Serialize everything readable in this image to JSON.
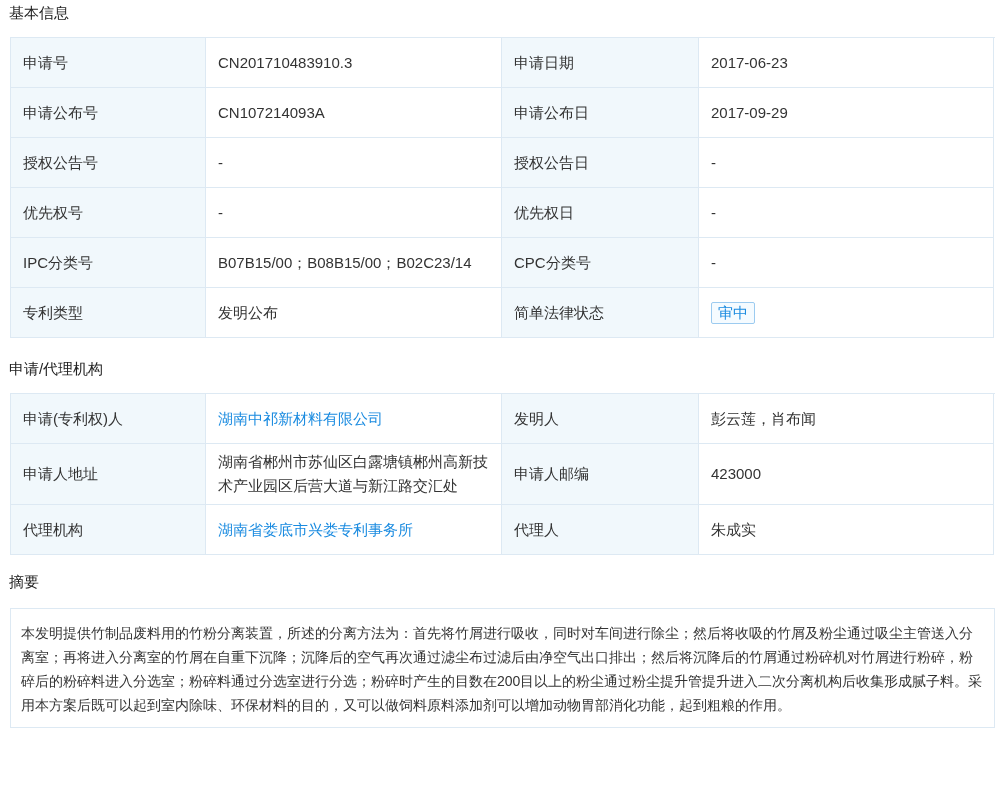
{
  "sections": [
    {
      "title": "基本信息",
      "rows": [
        {
          "cells": [
            {
              "kind": "label",
              "text": "申请号"
            },
            {
              "kind": "text",
              "text": "CN201710483910.3"
            },
            {
              "kind": "label",
              "text": "申请日期"
            },
            {
              "kind": "text",
              "text": "2017-06-23"
            }
          ]
        },
        {
          "cells": [
            {
              "kind": "label",
              "text": "申请公布号"
            },
            {
              "kind": "text",
              "text": "CN107214093A"
            },
            {
              "kind": "label",
              "text": "申请公布日"
            },
            {
              "kind": "text",
              "text": "2017-09-29"
            }
          ]
        },
        {
          "cells": [
            {
              "kind": "label",
              "text": "授权公告号"
            },
            {
              "kind": "text",
              "text": "-"
            },
            {
              "kind": "label",
              "text": "授权公告日"
            },
            {
              "kind": "text",
              "text": "-"
            }
          ]
        },
        {
          "cells": [
            {
              "kind": "label",
              "text": "优先权号"
            },
            {
              "kind": "text",
              "text": "-"
            },
            {
              "kind": "label",
              "text": "优先权日"
            },
            {
              "kind": "text",
              "text": "-"
            }
          ]
        },
        {
          "cells": [
            {
              "kind": "label",
              "text": "IPC分类号"
            },
            {
              "kind": "text",
              "text": "B07B15/00；B08B15/00；B02C23/14"
            },
            {
              "kind": "label",
              "text": "CPC分类号"
            },
            {
              "kind": "text",
              "text": "-"
            }
          ]
        },
        {
          "cells": [
            {
              "kind": "label",
              "text": "专利类型"
            },
            {
              "kind": "text",
              "text": "发明公布"
            },
            {
              "kind": "label",
              "text": "简单法律状态"
            },
            {
              "kind": "tag",
              "text": "审中"
            }
          ]
        }
      ]
    },
    {
      "title": "申请/代理机构",
      "rows": [
        {
          "cells": [
            {
              "kind": "label",
              "text": "申请(专利权)人"
            },
            {
              "kind": "link",
              "text": "湖南中祁新材料有限公司"
            },
            {
              "kind": "label",
              "text": "发明人"
            },
            {
              "kind": "text",
              "text": "彭云莲，肖布闻"
            }
          ]
        },
        {
          "cells": [
            {
              "kind": "label",
              "text": "申请人地址"
            },
            {
              "kind": "text",
              "text": "湖南省郴州市苏仙区白露塘镇郴州高新技术产业园区后营大道与新江路交汇处"
            },
            {
              "kind": "label",
              "text": "申请人邮编"
            },
            {
              "kind": "text",
              "text": "423000"
            }
          ]
        },
        {
          "cells": [
            {
              "kind": "label",
              "text": "代理机构"
            },
            {
              "kind": "link",
              "text": "湖南省娄底市兴娄专利事务所"
            },
            {
              "kind": "label",
              "text": "代理人"
            },
            {
              "kind": "text",
              "text": "朱成实"
            }
          ]
        }
      ]
    }
  ],
  "abstract": {
    "title": "摘要",
    "text": "本发明提供竹制品废料用的竹粉分离装置，所述的分离方法为：首先将竹屑进行吸收，同时对车间进行除尘；然后将收吸的竹屑及粉尘通过吸尘主管送入分离室；再将进入分离室的竹屑在自重下沉降；沉降后的空气再次通过滤尘布过滤后由净空气出口排出；然后将沉降后的竹屑通过粉碎机对竹屑进行粉碎，粉碎后的粉碎料进入分选室；粉碎料通过分选室进行分选；粉碎时产生的目数在200目以上的粉尘通过粉尘提升管提升进入二次分离机构后收集形成腻子料。采用本方案后既可以起到室内除味、环保材料的目的，又可以做饲料原料添加剂可以增加动物胃部消化功能，起到粗粮的作用。"
  }
}
